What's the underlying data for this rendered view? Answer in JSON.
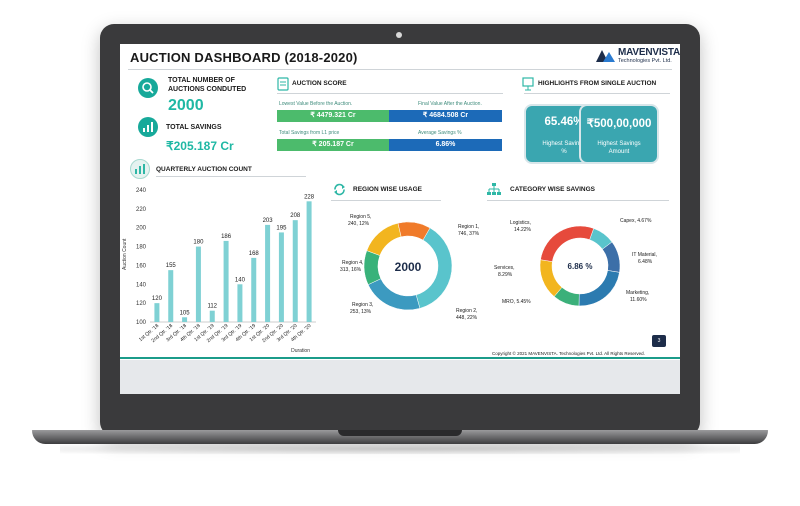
{
  "dashboard": {
    "title": "AUCTION DASHBOARD (2018-2020)",
    "logo_main": "MAVENVISTA",
    "logo_sub": "Technologies Pvt. Ltd."
  },
  "kpis": {
    "auctions_label": "TOTAL NUMBER OF AUCTIONS CONDUTED",
    "auctions_value": "2000",
    "savings_label": "TOTAL SAVINGS",
    "savings_value": "₹205.187 Cr"
  },
  "auction_score": {
    "title": "AUCTION SCORE",
    "lowest_label": "Lowest Value Before the Auction.",
    "lowest_value": "₹ 4479.321 Cr",
    "final_label": "Final Value After the Auction.",
    "final_value": "₹ 4684.508 Cr",
    "l1_label": "Total Savings from L1 price",
    "l1_value": "₹ 205.187 Cr",
    "avg_label": "Average Savings %",
    "avg_value": "6.86%"
  },
  "highlights": {
    "title": "HIGHLIGHTS FROM SINGLE AUCTION",
    "pct_value": "65.46%",
    "pct_label": "Highest Savings %",
    "amt_value": "₹500,00,000",
    "amt_label": "Highest Savings Amount"
  },
  "quarterly": {
    "title": "QUARTERLY AUCTION COUNT"
  },
  "region": {
    "title": "REGION WISE USAGE",
    "center": "2000",
    "labels": [
      "Region 5,",
      "240, 12%",
      "Region 1,",
      "746, 37%",
      "Region 4,",
      "313, 16%",
      "Region 3,",
      "253, 13%",
      "Region 2,",
      "448, 22%"
    ]
  },
  "category": {
    "title": "CATEGORY WISE SAVINGS",
    "center": "6.86 %",
    "labels": [
      "Logistics,",
      "14.22%",
      "Capex, 4.67%",
      "IT Material,",
      "6.48%",
      "Services,",
      "8.29%",
      "Marketing,",
      "11.60%",
      "MRO, 5.45%"
    ]
  },
  "footer": {
    "copyright": "Copyright © 2021 MAVENVISTA. Technologies Pvt. Ltd. All Rights Reserved.",
    "page": "3"
  },
  "icons": {
    "search": "search-icon",
    "savings": "bar-chart-icon",
    "quarterly": "chart-icon",
    "score": "document-icon",
    "highlights": "presentation-icon",
    "region": "refresh-icon",
    "category": "hierarchy-icon"
  },
  "colors": {
    "teal": "#1fb8a4",
    "green": "#4cbb6c",
    "blue": "#1c6ab8",
    "highlight_box": "#3aa6b0"
  },
  "chart_data": [
    {
      "type": "bar",
      "title": "QUARTERLY AUCTION COUNT",
      "xlabel": "Duration",
      "ylabel": "Auction Count",
      "categories": [
        "1st Qtr. '18",
        "2nd Qtr. '18",
        "3rd Qtr. '18",
        "4th Qtr. '18",
        "1st Qtr. '19",
        "2nd Qtr. '19",
        "3rd Qtr. '19",
        "4th Qtr. '19",
        "1st Qtr. '20",
        "2nd Qtr. '20",
        "3rd Qtr. '20",
        "4th Qtr. '20"
      ],
      "values": [
        120,
        155,
        105,
        180,
        112,
        186,
        140,
        168,
        203,
        195,
        208,
        228
      ],
      "ylim": [
        100,
        240
      ],
      "yticks": [
        100,
        120,
        140,
        160,
        180,
        200,
        220,
        240
      ]
    },
    {
      "type": "pie",
      "title": "REGION WISE USAGE",
      "labels": [
        "Region 1",
        "Region 2",
        "Region 3",
        "Region 4",
        "Region 5"
      ],
      "values": [
        746,
        448,
        253,
        313,
        240
      ],
      "percents": [
        37,
        22,
        13,
        16,
        12
      ]
    },
    {
      "type": "pie",
      "title": "CATEGORY WISE SAVINGS",
      "labels": [
        "Capex",
        "IT Material",
        "Marketing",
        "MRO",
        "Services",
        "Logistics"
      ],
      "values": [
        4.67,
        6.48,
        11.6,
        5.45,
        8.29,
        14.22
      ]
    }
  ]
}
